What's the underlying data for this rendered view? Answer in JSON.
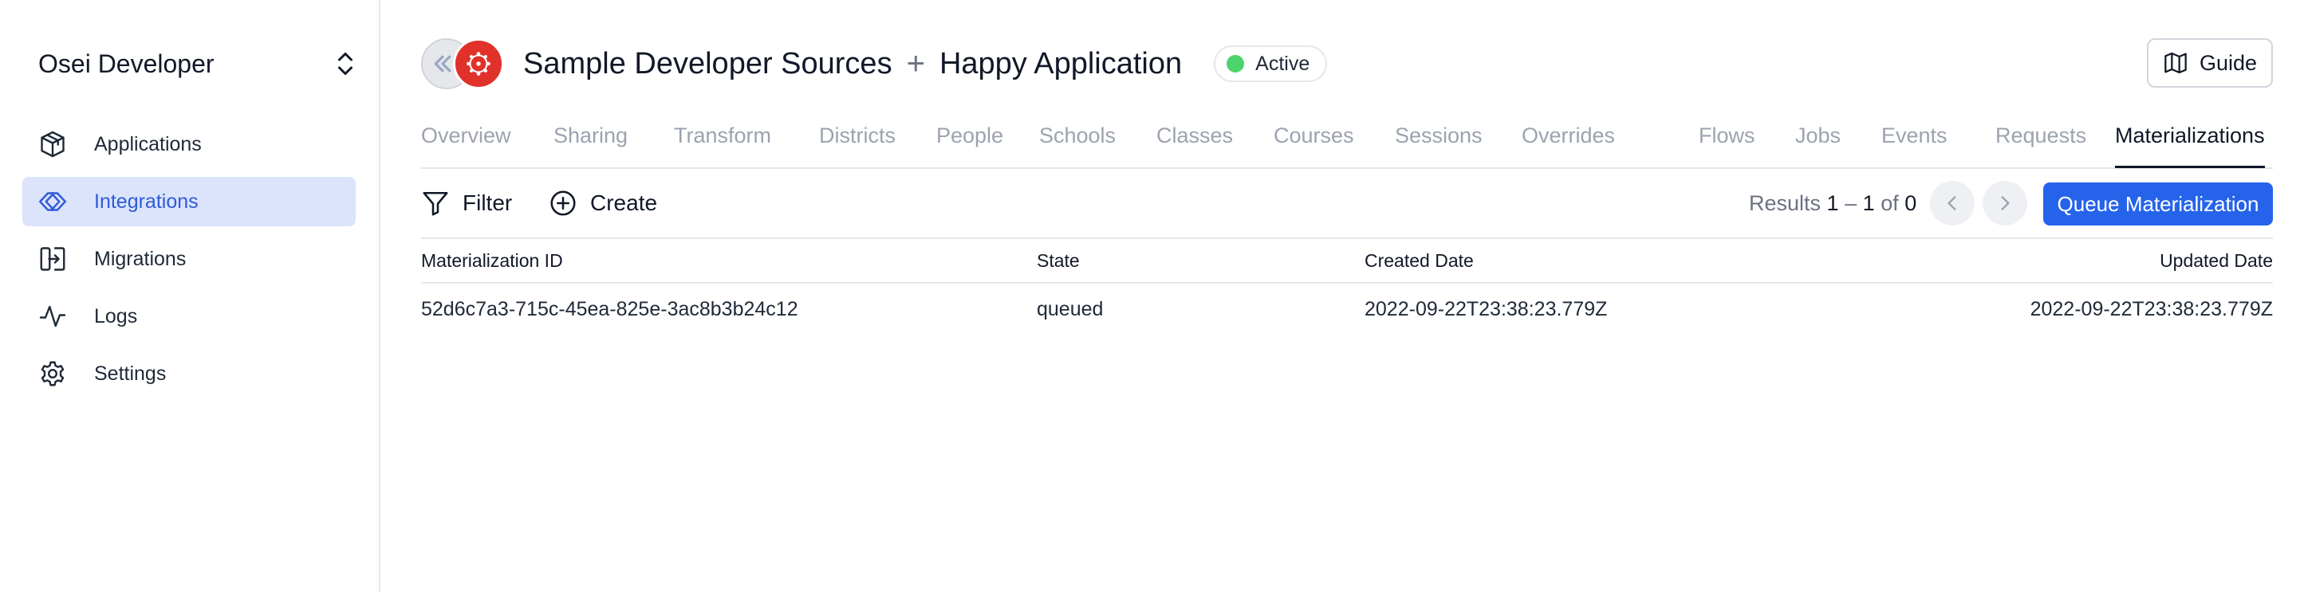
{
  "sidebar": {
    "org_name": "Osei Developer",
    "items": [
      {
        "label": "Applications",
        "icon": "cube-icon"
      },
      {
        "label": "Integrations",
        "icon": "integration-icon",
        "active": true
      },
      {
        "label": "Migrations",
        "icon": "migration-icon"
      },
      {
        "label": "Logs",
        "icon": "activity-icon"
      },
      {
        "label": "Settings",
        "icon": "gear-icon"
      }
    ]
  },
  "header": {
    "source_name": "Sample Developer Sources",
    "separator": "+",
    "app_name": "Happy Application",
    "status": "Active",
    "status_color": "#4cd46c",
    "guide_label": "Guide"
  },
  "tabs": [
    {
      "label": "Overview"
    },
    {
      "label": "Sharing"
    },
    {
      "label": "Transform"
    },
    {
      "label": "Districts"
    },
    {
      "label": "People"
    },
    {
      "label": "Schools"
    },
    {
      "label": "Classes"
    },
    {
      "label": "Courses"
    },
    {
      "label": "Sessions"
    },
    {
      "label": "Overrides"
    },
    {
      "label": "Flows"
    },
    {
      "label": "Jobs"
    },
    {
      "label": "Events"
    },
    {
      "label": "Requests"
    },
    {
      "label": "Materializations",
      "active": true
    }
  ],
  "toolbar": {
    "filter_label": "Filter",
    "create_label": "Create",
    "results_prefix": "Results",
    "results_start": "1",
    "results_dash": "–",
    "results_end": "1",
    "results_of": "of",
    "results_total": "0",
    "queue_label": "Queue Materialization",
    "accent_color": "#2563eb"
  },
  "table": {
    "columns": [
      "Materialization ID",
      "State",
      "Created Date",
      "Updated Date"
    ],
    "rows": [
      [
        "52d6c7a3-715c-45ea-825e-3ac8b3b24c12",
        "queued",
        "2022-09-22T23:38:23.779Z",
        "2022-09-22T23:38:23.779Z"
      ]
    ]
  }
}
